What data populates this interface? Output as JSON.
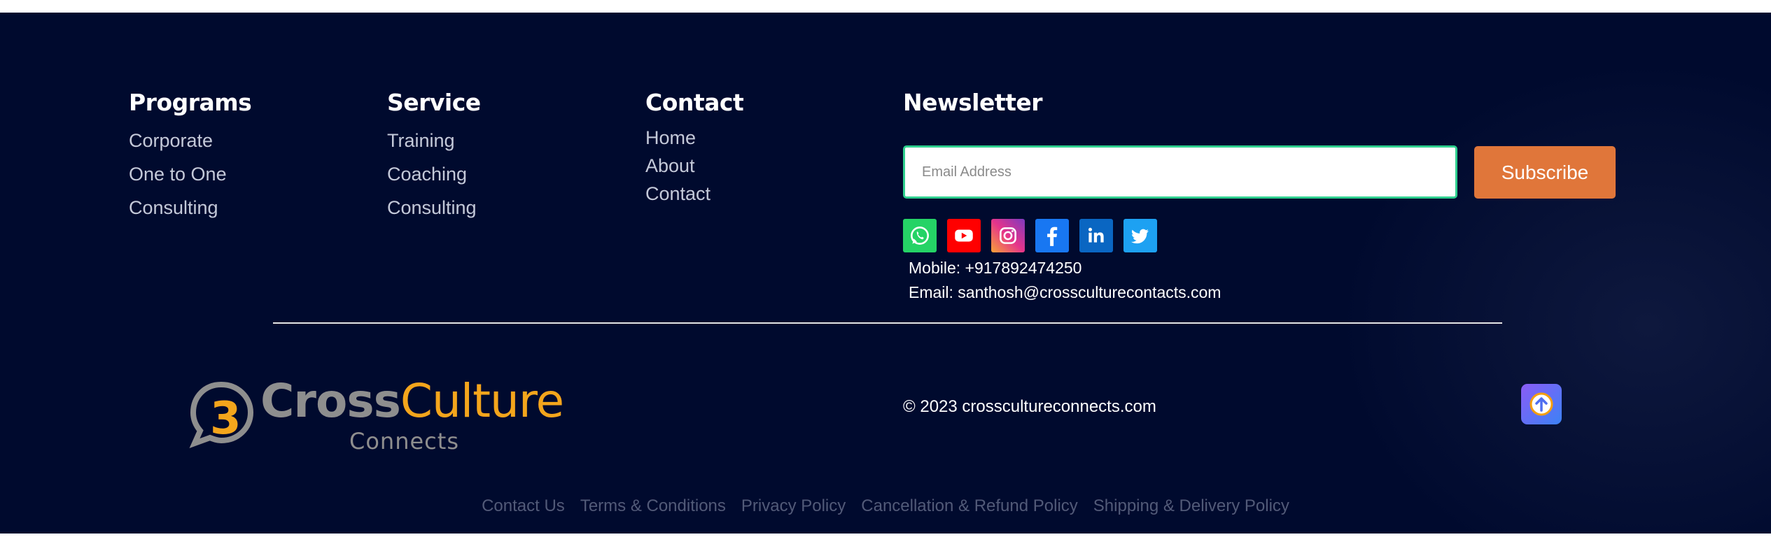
{
  "programs": {
    "title": "Programs",
    "items": [
      "Corporate",
      "One to One",
      "Consulting"
    ]
  },
  "service": {
    "title": "Service",
    "items": [
      "Training",
      "Coaching",
      "Consulting"
    ]
  },
  "contact": {
    "title": "Contact",
    "items": [
      "Home",
      "About",
      "Contact"
    ]
  },
  "newsletter": {
    "title": "Newsletter",
    "email_placeholder": "Email Address",
    "subscribe_label": "Subscribe",
    "mobile": "Mobile: +917892474250",
    "email": "Email: santhosh@crossculturecontacts.com"
  },
  "socials": [
    {
      "icon": "whatsapp-icon",
      "color": "#25d366"
    },
    {
      "icon": "youtube-icon",
      "color": "#ff0000"
    },
    {
      "icon": "instagram-icon",
      "color": "#e5348b"
    },
    {
      "icon": "facebook-icon",
      "color": "#1877f2"
    },
    {
      "icon": "linkedin-icon",
      "color": "#0a66c2"
    },
    {
      "icon": "twitter-icon",
      "color": "#1da1f2"
    }
  ],
  "logo": {
    "word_cross": "Cross",
    "word_culture": "Culture",
    "sub": "Connects",
    "mark": "3"
  },
  "copyright": "© 2023 crosscultureconnects.com",
  "legal_links": [
    "Contact Us",
    "Terms & Conditions",
    "Privacy Policy",
    "Cancellation & Refund Policy",
    "Shipping & Delivery Policy"
  ],
  "colors": {
    "background": "#000a2e",
    "accent_orange": "#e0763a",
    "logo_orange": "#f4a51c",
    "field_border": "#2ecf8e"
  }
}
